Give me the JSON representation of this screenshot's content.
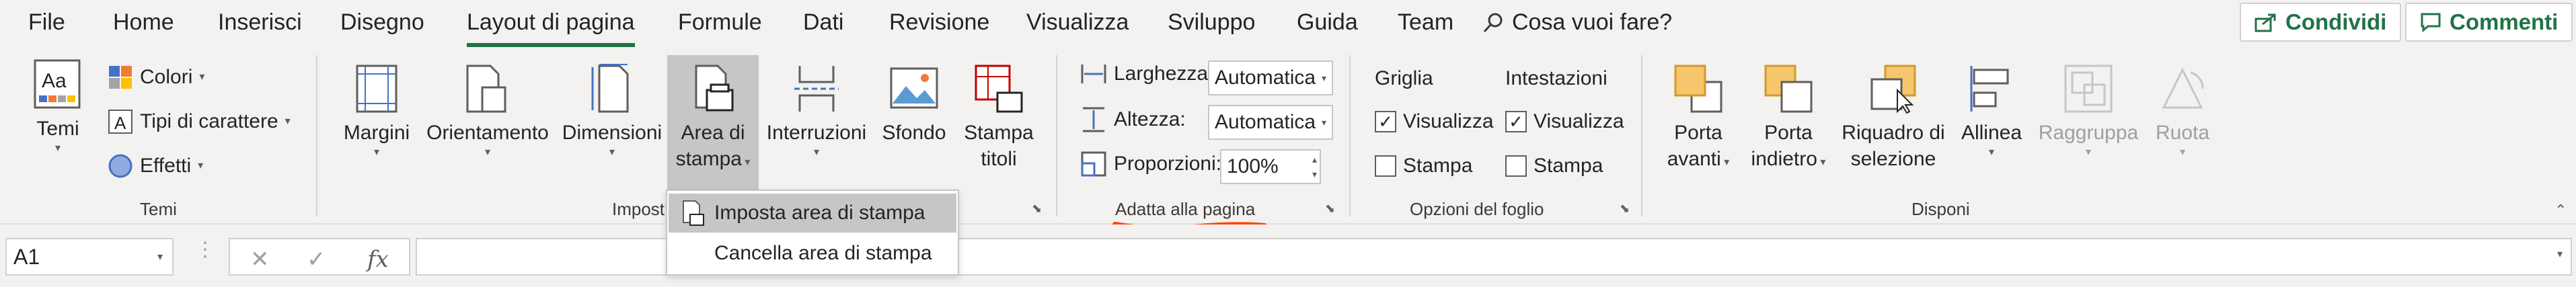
{
  "tabs": [
    "File",
    "Home",
    "Inserisci",
    "Disegno",
    "Layout di pagina",
    "Formule",
    "Dati",
    "Revisione",
    "Visualizza",
    "Sviluppo",
    "Guida",
    "Team"
  ],
  "active_tab": "Layout di pagina",
  "tell_me": "Cosa vuoi fare?",
  "share_label": "Condividi",
  "comments_label": "Commenti",
  "groups": {
    "temi": {
      "label": "Temi",
      "temi_btn": "Temi",
      "colori": "Colori",
      "tipi_carattere": "Tipi di carattere",
      "effetti": "Effetti"
    },
    "imposta": {
      "label": "Impost",
      "margini": "Margini",
      "orientamento": "Orientamento",
      "dimensioni": "Dimensioni",
      "area_stampa_1": "Area di",
      "area_stampa_2": "stampa",
      "interruzioni": "Interruzioni",
      "sfondo": "Sfondo",
      "stampa_titoli_1": "Stampa",
      "stampa_titoli_2": "titoli"
    },
    "adatta": {
      "label": "Adatta alla pagina",
      "larghezza": "Larghezza:",
      "larghezza_val": "Automatica",
      "altezza": "Altezza:",
      "altezza_val": "Automatica",
      "proporzioni": "Proporzioni:",
      "proporzioni_val": "100%"
    },
    "opzioni": {
      "label": "Opzioni del foglio",
      "griglia": "Griglia",
      "intestazioni": "Intestazioni",
      "visualizza": "Visualizza",
      "stampa": "Stampa"
    },
    "disponi": {
      "label": "Disponi",
      "porta_avanti_1": "Porta",
      "porta_avanti_2": "avanti",
      "porta_indietro_1": "Porta",
      "porta_indietro_2": "indietro",
      "riquadro_1": "Riquadro di",
      "riquadro_2": "selezione",
      "allinea": "Allinea",
      "raggruppa": "Raggruppa",
      "ruota": "Ruota"
    }
  },
  "dropdown_menu": {
    "item1": "Imposta area di stampa",
    "item2": "Cancella area di stampa"
  },
  "formula_bar": {
    "name_box": "A1",
    "fx": "fx",
    "value": ""
  },
  "colors": {
    "accent": "#217346",
    "annotation": "#ff4500"
  }
}
